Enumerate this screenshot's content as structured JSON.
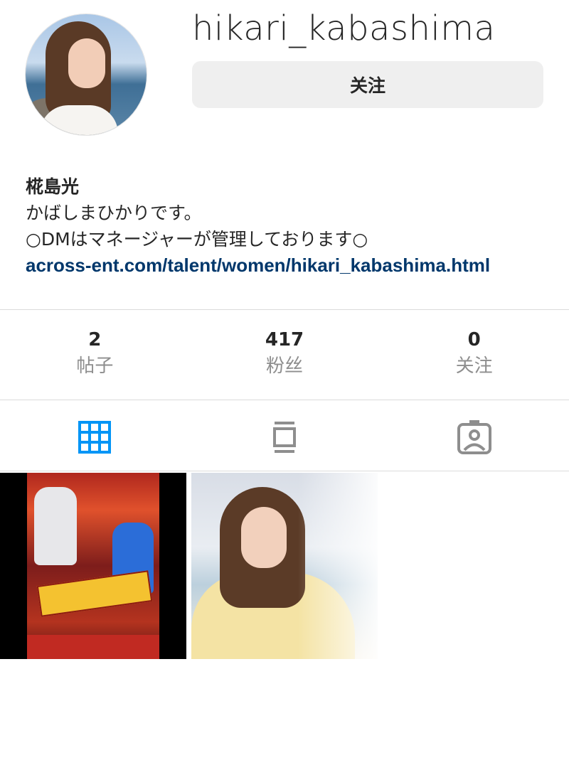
{
  "profile": {
    "username": "hikari_kabashima",
    "follow_button": "关注",
    "display_name": "椛島光",
    "bio_line1": "かばしまひかりです。",
    "bio_line2": "○DMはマネージャーが管理しております○",
    "link": "across-ent.com/talent/women/hikari_kabashima.html"
  },
  "stats": [
    {
      "value": "2",
      "label": "帖子"
    },
    {
      "value": "417",
      "label": "粉丝"
    },
    {
      "value": "0",
      "label": "关注"
    }
  ],
  "tabs": [
    {
      "icon": "grid-icon",
      "active": true
    },
    {
      "icon": "feed-icon",
      "active": false
    },
    {
      "icon": "tagged-icon",
      "active": false
    }
  ],
  "colors": {
    "accent": "#0095f6",
    "link": "#00376b",
    "muted": "#8e8e8e",
    "button_bg": "#efefef"
  }
}
